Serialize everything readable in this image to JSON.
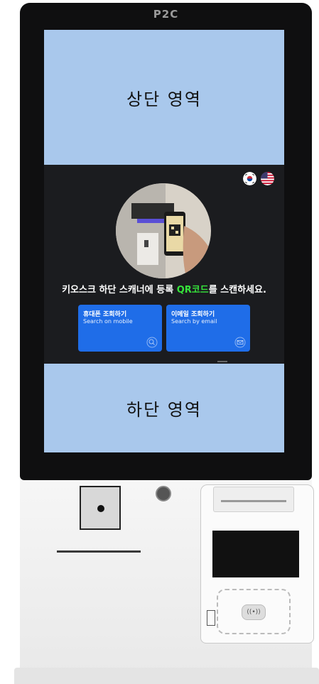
{
  "device": {
    "brand": "P2C"
  },
  "screen": {
    "top_area_label": "상단 영역",
    "bottom_area_label": "하단 영역",
    "instruction": {
      "before": "키오스크 하단 스캐너에 등록 ",
      "highlight": "QR코드",
      "after": "를 스캔하세요."
    },
    "buttons": [
      {
        "title": "휴대폰 조회하기",
        "subtitle": "Search on mobile",
        "icon": "search-icon"
      },
      {
        "title": "이메일 조회하기",
        "subtitle": "Search by email",
        "icon": "email-search-icon"
      }
    ],
    "languages": [
      {
        "code": "ko",
        "icon": "korea-flag-icon"
      },
      {
        "code": "en",
        "icon": "usa-flag-icon"
      }
    ]
  },
  "colors": {
    "area_background": "#a9c8ec",
    "panel_background": "#1b1c1f",
    "button_blue": "#1f6de8",
    "qr_highlight": "#36e33b"
  }
}
